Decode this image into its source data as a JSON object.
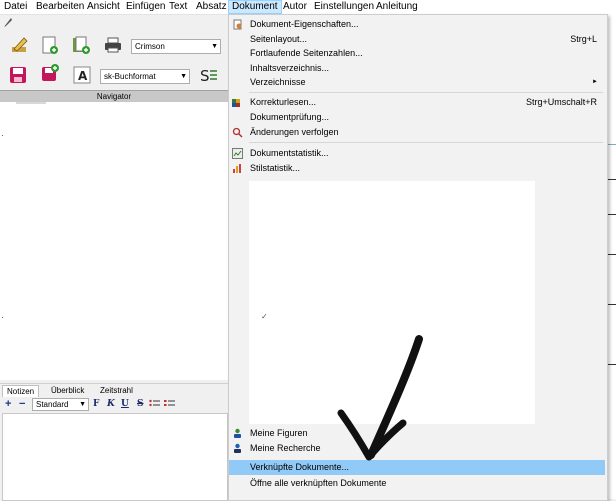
{
  "menubar": {
    "items": [
      "Datei",
      "Bearbeiten",
      "Ansicht",
      "Einfügen",
      "Text",
      "Absatz",
      "Dokument",
      "Autor",
      "Einstellungen",
      "Anleitung"
    ]
  },
  "toolbar": {
    "font_name": "Crimson",
    "style_name": "sk-Buchformat"
  },
  "navigator": {
    "title": "Navigator"
  },
  "notes_tabs": [
    "Notizen",
    "Überblick",
    "Zeitstrahl"
  ],
  "notes_toolbar": {
    "style": "Standard",
    "bold": "F",
    "italic": "K",
    "underline": "U",
    "strike": "S"
  },
  "menu": {
    "items": [
      {
        "label": "Dokument-Eigenschaften...",
        "shortcut": ""
      },
      {
        "label": "Seitenlayout...",
        "shortcut": "Strg+L"
      },
      {
        "label": "Fortlaufende Seitenzahlen...",
        "shortcut": ""
      },
      {
        "label": "Inhaltsverzeichnis...",
        "shortcut": ""
      },
      {
        "label": "Verzeichnisse",
        "shortcut": ""
      },
      {
        "label": "Korrekturlesen...",
        "shortcut": "Strg+Umschalt+R"
      },
      {
        "label": "Dokumentprüfung...",
        "shortcut": ""
      },
      {
        "label": "Änderungen verfolgen",
        "shortcut": ""
      },
      {
        "label": "Dokumentstatistik...",
        "shortcut": ""
      },
      {
        "label": "Stilstatistik...",
        "shortcut": ""
      },
      {
        "label": "Meine Figuren",
        "shortcut": ""
      },
      {
        "label": "Meine Recherche",
        "shortcut": ""
      },
      {
        "label": "Verknüpfte Dokumente...",
        "shortcut": ""
      },
      {
        "label": "Öffne alle verknüpften Dokumente",
        "shortcut": ""
      }
    ],
    "submenu_arrow": "►",
    "check_mark": "✓"
  },
  "colors": {
    "highlight": "#91c9f7",
    "menu_bg": "#f2f2f2",
    "active_menubar": "#cce8ff"
  }
}
